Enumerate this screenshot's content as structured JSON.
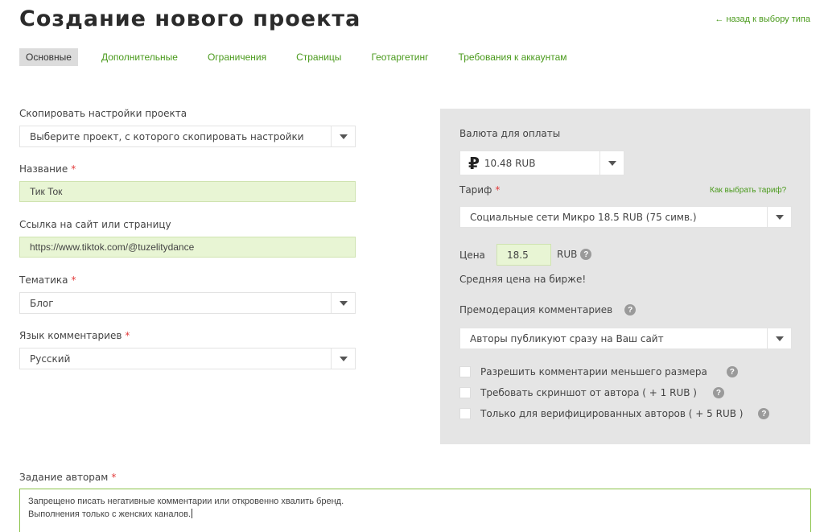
{
  "header": {
    "title": "Создание нового проекта",
    "back_link": "← назад к выбору типа"
  },
  "tabs": [
    {
      "label": "Основные",
      "active": true
    },
    {
      "label": "Дополнительные"
    },
    {
      "label": "Ограничения"
    },
    {
      "label": "Страницы"
    },
    {
      "label": "Геотаргетинг"
    },
    {
      "label": "Требования к аккаунтам"
    }
  ],
  "form": {
    "copy_settings": {
      "label": "Скопировать настройки проекта",
      "value": "Выберите проект, с которого скопировать настройки"
    },
    "name": {
      "label": "Название",
      "required_mark": "*",
      "value": "Тик Ток"
    },
    "url": {
      "label": "Ссылка на сайт или страницу",
      "value": "https://www.tiktok.com/@tuzelitydance"
    },
    "topic": {
      "label": "Тематика",
      "required_mark": "*",
      "value": "Блог"
    },
    "language": {
      "label": "Язык комментариев",
      "required_mark": "*",
      "value": "Русский"
    },
    "task": {
      "label": "Задание авторам",
      "required_mark": "*",
      "lines": [
        "Запрещено писать негативные комментарии или откровенно хвалить бренд.",
        "Выполнения только с женских каналов."
      ]
    }
  },
  "panel": {
    "currency": {
      "label": "Валюта для оплаты",
      "symbol": "₽",
      "value": "10.48 RUB"
    },
    "tariff": {
      "label": "Тариф",
      "required_mark": "*",
      "help_link": "Как выбрать тариф?",
      "value": "Социальные сети Микро 18.5 RUB (75 симв.)"
    },
    "price": {
      "label": "Цена",
      "value": "18.5",
      "unit": "RUB",
      "note": "Средняя цена на бирже!"
    },
    "premoderation": {
      "label": "Премодерация комментариев",
      "value": "Авторы публикуют сразу на Ваш сайт"
    },
    "options": [
      {
        "label": "Разрешить комментарии меньшего размера",
        "checked": false
      },
      {
        "label": "Требовать скриншот от автора ( + 1 RUB )",
        "checked": false
      },
      {
        "label": "Только для верифицированных авторов ( + 5 RUB )",
        "checked": false
      }
    ],
    "help_glyph": "?"
  },
  "colors": {
    "accent_green": "#4a9a1c",
    "input_green_bg": "#e8f5d4",
    "panel_bg": "#e5e5e5",
    "required_red": "#e23b3b"
  }
}
